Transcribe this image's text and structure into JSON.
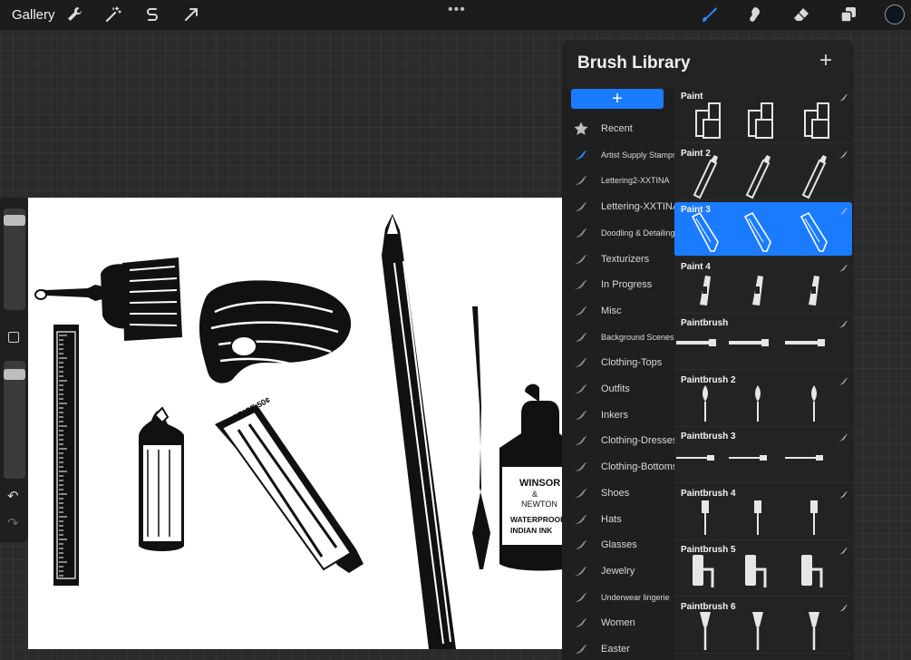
{
  "toolbar": {
    "gallery_label": "Gallery",
    "left_tools": [
      "wrench-icon",
      "magic-wand-icon",
      "selection-s-icon",
      "transform-arrow-icon"
    ],
    "center_menu": "•••",
    "right_tools": [
      "brush-icon",
      "smudge-icon",
      "eraser-icon",
      "layers-icon"
    ],
    "current_color": "#0f1621"
  },
  "sidebar": {
    "size_slider_level": 0.07,
    "opacity_slider_level": 0.08,
    "undo_glyph": "↶",
    "redo_glyph": "↷"
  },
  "library": {
    "title": "Brush Library",
    "add_glyph": "+",
    "new_set_glyph": "+",
    "sets": [
      {
        "label": "Recent",
        "icon": "star-icon"
      },
      {
        "label": "Artist Supply Stamps",
        "icon": "brush-stroke-icon",
        "selected": true
      },
      {
        "label": "Lettering2-XXTINA",
        "icon": "brush-stroke-icon"
      },
      {
        "label": "Lettering-XXTINA",
        "icon": "brush-stroke-icon"
      },
      {
        "label": "Doodling & Detailing",
        "icon": "brush-stroke-icon"
      },
      {
        "label": "Texturizers",
        "icon": "brush-stroke-icon"
      },
      {
        "label": "In Progress",
        "icon": "brush-stroke-icon"
      },
      {
        "label": "Misc",
        "icon": "brush-stroke-icon"
      },
      {
        "label": "Background Scenes",
        "icon": "brush-stroke-icon"
      },
      {
        "label": "Clothing-Tops",
        "icon": "brush-stroke-icon"
      },
      {
        "label": "Outfits",
        "icon": "brush-stroke-icon"
      },
      {
        "label": "Inkers",
        "icon": "brush-stroke-icon"
      },
      {
        "label": "Clothing-Dresses",
        "icon": "brush-stroke-icon"
      },
      {
        "label": "Clothing-Bottoms",
        "icon": "brush-stroke-icon"
      },
      {
        "label": "Shoes",
        "icon": "brush-stroke-icon"
      },
      {
        "label": "Hats",
        "icon": "brush-stroke-icon"
      },
      {
        "label": "Glasses",
        "icon": "brush-stroke-icon"
      },
      {
        "label": "Jewelry",
        "icon": "brush-stroke-icon"
      },
      {
        "label": "Underwear lingerie",
        "icon": "brush-stroke-icon"
      },
      {
        "label": "Women",
        "icon": "brush-stroke-icon"
      },
      {
        "label": "Easter",
        "icon": "brush-stroke-icon"
      }
    ],
    "brushes": [
      {
        "name": "Paint",
        "preview": "paint-tubes-box"
      },
      {
        "name": "Paint 2",
        "preview": "paint-tubes-diagonal"
      },
      {
        "name": "Paint 3",
        "preview": "paint-tubes-outline",
        "selected": true
      },
      {
        "name": "Paint 4",
        "preview": "paint-tubes-small"
      },
      {
        "name": "Paintbrush",
        "preview": "paintbrush-flat"
      },
      {
        "name": "Paintbrush 2",
        "preview": "paintbrush-round"
      },
      {
        "name": "Paintbrush 3",
        "preview": "paintbrush-thin"
      },
      {
        "name": "Paintbrush 4",
        "preview": "paintbrush-wide"
      },
      {
        "name": "Paintbrush 5",
        "preview": "paint-roller"
      },
      {
        "name": "Paintbrush 6",
        "preview": "paintbrush-fan"
      }
    ]
  },
  "canvas": {
    "objects": [
      "paintbrush",
      "palette",
      "pencil",
      "ruler",
      "spray-can",
      "paint-tube",
      "ink-pen",
      "ink-bottle"
    ],
    "price_label": "PRICE 50¢",
    "bottle_label_1": "WINSOR",
    "bottle_label_2": "&",
    "bottle_label_3": "NEWTON",
    "bottle_label_4": "WATERPROOF",
    "bottle_label_5": "INDIAN INK"
  }
}
